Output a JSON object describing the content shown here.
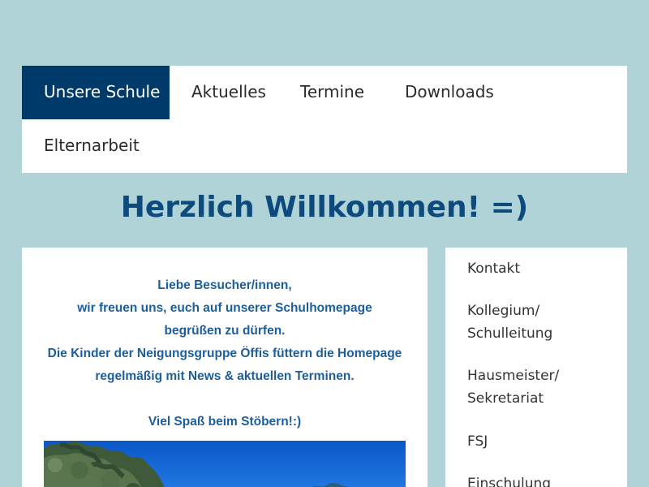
{
  "nav": {
    "items": [
      {
        "label": "Unsere Schule",
        "active": true
      },
      {
        "label": "Aktuelles",
        "active": false
      },
      {
        "label": "Termine",
        "active": false
      },
      {
        "label": "Downloads",
        "active": false
      },
      {
        "label": "Elternarbeit",
        "active": false
      }
    ]
  },
  "welcome": {
    "title": "Herzlich Willkommen! =)"
  },
  "content": {
    "lines": [
      "Liebe Besucher/innen,",
      "wir freuen uns, euch auf unserer Schulhomepage",
      "begrüßen zu dürfen.",
      "Die Kinder der Neigungsgruppe Öffis füttern die Homepage",
      "regelmäßig mit News & aktuellen Terminen.",
      "",
      "Viel Spaß beim Stöbern!:)"
    ]
  },
  "sidebar": {
    "items": [
      {
        "label": "Kontakt"
      },
      {
        "label": "Kollegium/ Schulleitung"
      },
      {
        "label": "Hausmeister/ Sekretariat"
      },
      {
        "label": "FSJ"
      },
      {
        "label": "Einschulung"
      }
    ]
  },
  "colors": {
    "background": "#b0d3d7",
    "nav_active": "#003a6b",
    "heading": "#0d4a7d",
    "intro_text": "#1d5f9d"
  }
}
